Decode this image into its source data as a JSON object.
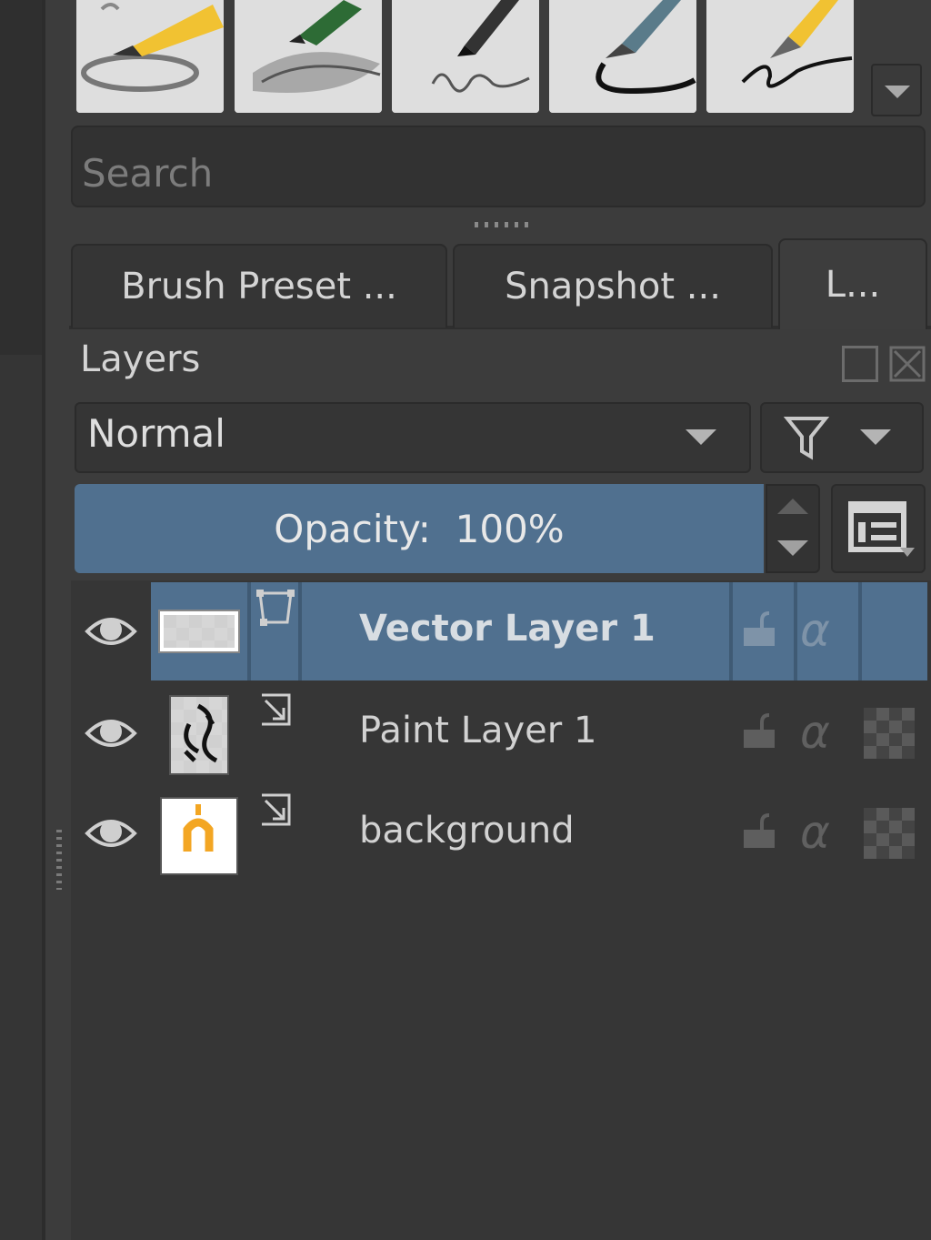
{
  "presets": [
    {
      "name": "pencil-sketch-preset"
    },
    {
      "name": "colored-pencil-preset"
    },
    {
      "name": "ink-pen-preset"
    },
    {
      "name": "fineliner-preset"
    },
    {
      "name": "fountain-pen-preset"
    }
  ],
  "search": {
    "placeholder": "Search"
  },
  "tabs": [
    {
      "label": "Brush Preset ..."
    },
    {
      "label": "Snapshot ..."
    },
    {
      "label": "L..."
    }
  ],
  "docker": {
    "title": "Layers"
  },
  "blend": {
    "value": "Normal"
  },
  "opacity": {
    "label": "Opacity:",
    "value": "100%",
    "level_percent": 100
  },
  "layers": [
    {
      "name": "Vector Layer 1",
      "selected": true,
      "type": "vector"
    },
    {
      "name": "Paint Layer 1",
      "selected": false,
      "type": "paint"
    },
    {
      "name": "background",
      "selected": false,
      "type": "paint"
    }
  ],
  "colors": {
    "accent": "#50708f",
    "panel": "#3c3c3c",
    "list": "#363636"
  }
}
